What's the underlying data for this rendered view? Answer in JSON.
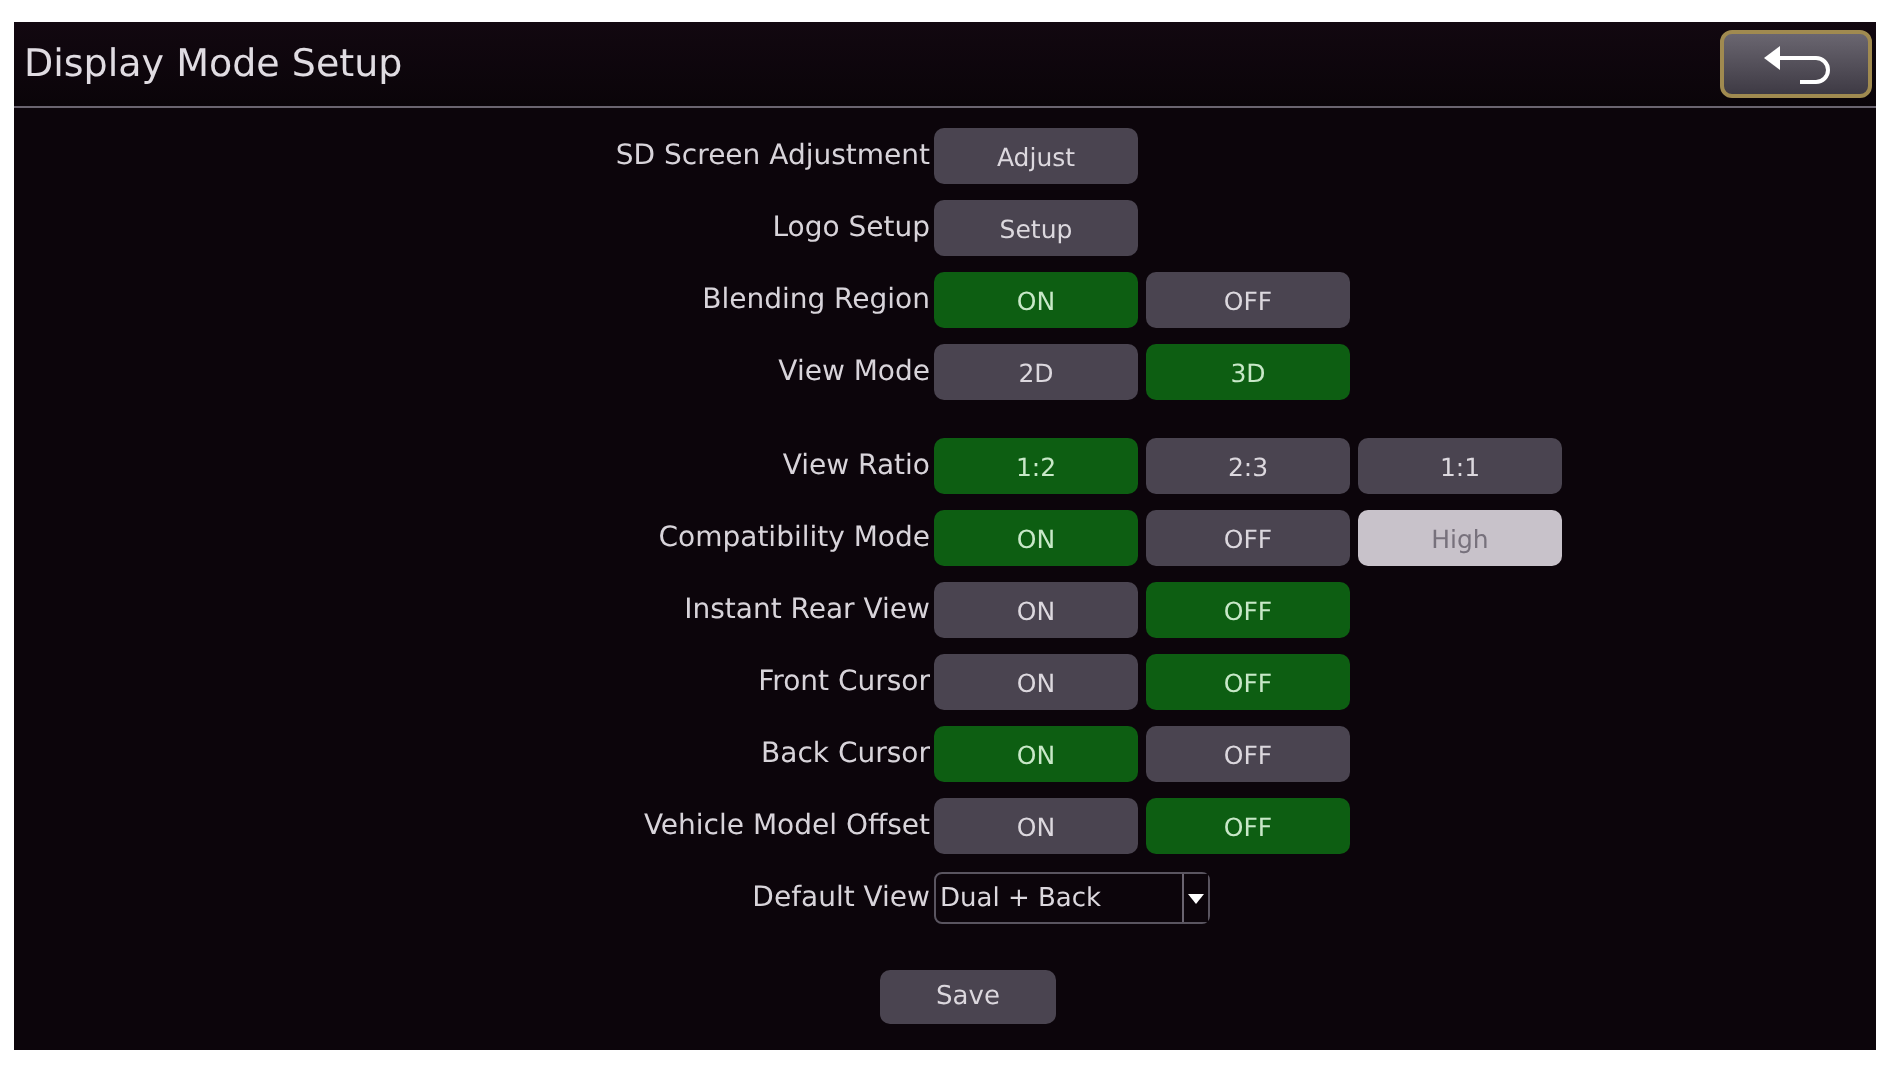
{
  "header": {
    "title": "Display Mode Setup"
  },
  "rows": [
    {
      "kind": "action",
      "label": "SD Screen Adjustment",
      "button": "Adjust"
    },
    {
      "kind": "action",
      "label": "Logo Setup",
      "button": "Setup"
    },
    {
      "kind": "choice",
      "label": "Blending Region",
      "options": [
        {
          "label": "ON",
          "selected": true,
          "disabled": false
        },
        {
          "label": "OFF",
          "selected": false,
          "disabled": false
        }
      ]
    },
    {
      "kind": "choice",
      "label": "View Mode",
      "options": [
        {
          "label": "2D",
          "selected": false,
          "disabled": false
        },
        {
          "label": "3D",
          "selected": true,
          "disabled": false
        }
      ]
    },
    {
      "kind": "choice",
      "label": "View Ratio",
      "options": [
        {
          "label": "1:2",
          "selected": true,
          "disabled": false
        },
        {
          "label": "2:3",
          "selected": false,
          "disabled": false
        },
        {
          "label": "1:1",
          "selected": false,
          "disabled": false
        }
      ]
    },
    {
      "kind": "choice",
      "label": "Compatibility Mode",
      "options": [
        {
          "label": "ON",
          "selected": true,
          "disabled": false
        },
        {
          "label": "OFF",
          "selected": false,
          "disabled": false
        },
        {
          "label": "High",
          "selected": false,
          "disabled": true
        }
      ]
    },
    {
      "kind": "choice",
      "label": "Instant Rear View",
      "options": [
        {
          "label": "ON",
          "selected": false,
          "disabled": false
        },
        {
          "label": "OFF",
          "selected": true,
          "disabled": false
        }
      ]
    },
    {
      "kind": "choice",
      "label": "Front Cursor",
      "options": [
        {
          "label": "ON",
          "selected": false,
          "disabled": false
        },
        {
          "label": "OFF",
          "selected": true,
          "disabled": false
        }
      ]
    },
    {
      "kind": "choice",
      "label": "Back Cursor",
      "options": [
        {
          "label": "ON",
          "selected": true,
          "disabled": false
        },
        {
          "label": "OFF",
          "selected": false,
          "disabled": false
        }
      ]
    },
    {
      "kind": "choice",
      "label": "Vehicle Model Offset",
      "options": [
        {
          "label": "ON",
          "selected": false,
          "disabled": false
        },
        {
          "label": "OFF",
          "selected": true,
          "disabled": false
        }
      ]
    },
    {
      "kind": "select",
      "label": "Default View",
      "value": "Dual + Back"
    }
  ],
  "save_button": "Save"
}
